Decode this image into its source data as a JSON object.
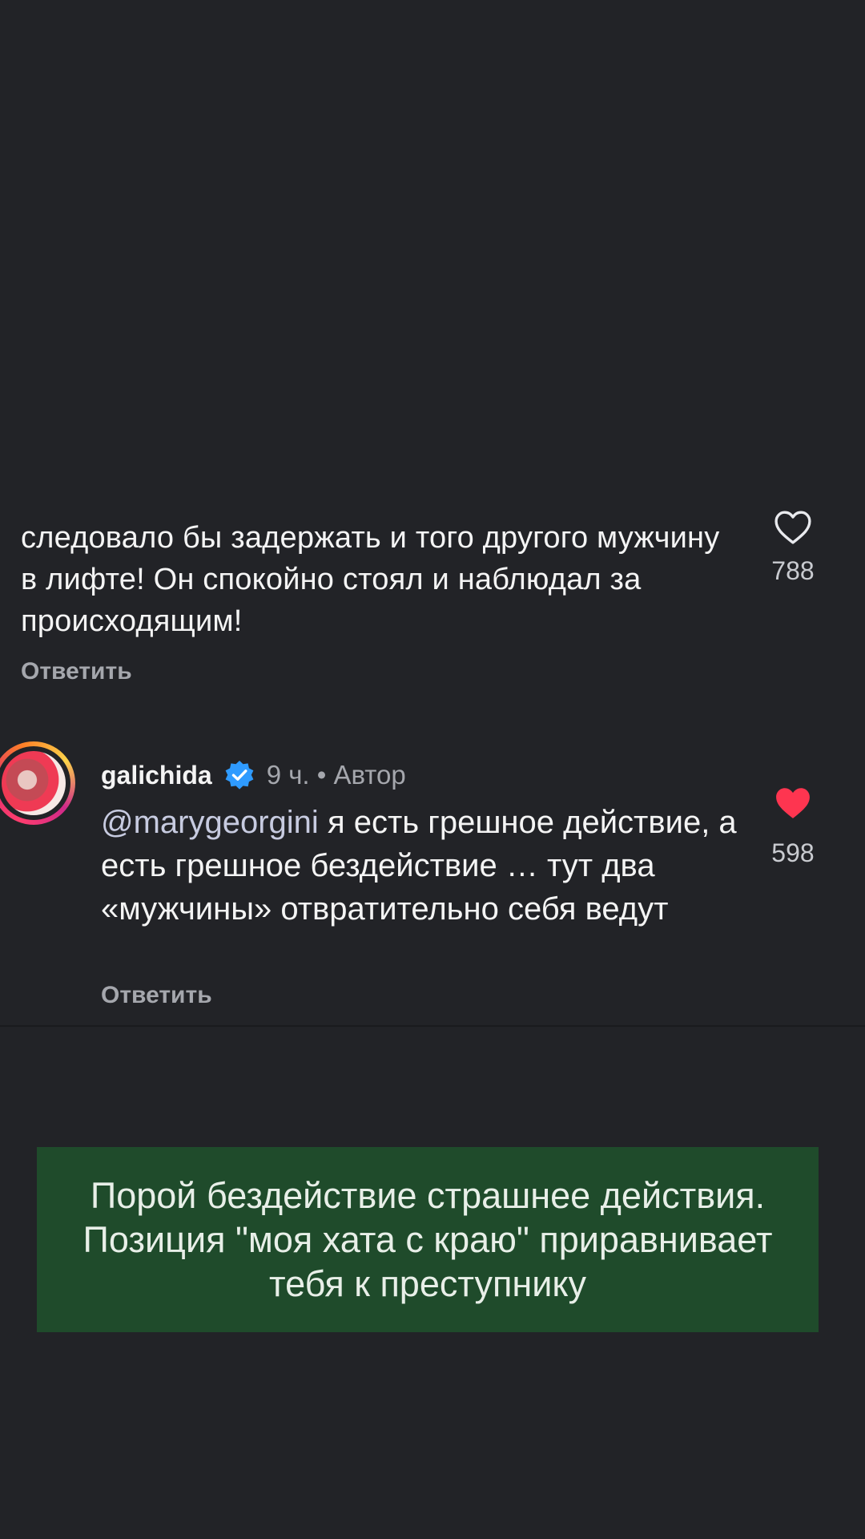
{
  "comment_1": {
    "text": "следовало бы задержать и того другого мужчину в лифте! Он спокойно стоял и наблюдал за происходящим!",
    "reply_label": "Ответить",
    "like_icon": "heart-outline-icon",
    "like_count": "788"
  },
  "comment_2": {
    "username": "galichida",
    "verified_icon": "verified-badge-icon",
    "meta": "9 ч. • Автор",
    "mention": "@marygeorgini",
    "text": " я  есть грешное действие, а есть грешное бездействие … тут два «мужчины» отвратительно себя ведут",
    "reply_label": "Ответить",
    "like_icon": "heart-filled-icon",
    "like_count": "598",
    "colors": {
      "liked_heart": "#fe3550",
      "verified": "#2f9bff"
    }
  },
  "caption": {
    "text": "Порой бездействие страшнее действия. Позиция \"моя хата с краю\" приравнивает тебя к преступнику",
    "background": "#1f4b2b"
  }
}
